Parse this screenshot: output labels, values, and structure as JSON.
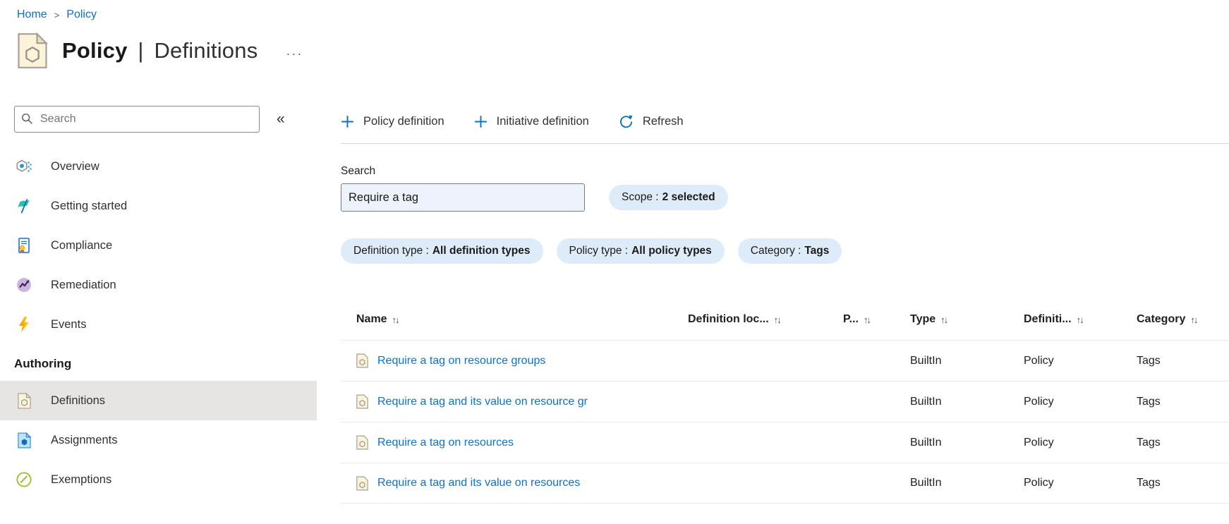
{
  "breadcrumb": {
    "separator": ">",
    "items": [
      {
        "label": "Home"
      },
      {
        "label": "Policy"
      }
    ]
  },
  "header": {
    "title_primary": "Policy",
    "title_separator": "|",
    "title_secondary": "Definitions",
    "more_glyph": "···"
  },
  "sidebar": {
    "search_placeholder": "Search",
    "collapse_glyph": "«",
    "items": [
      {
        "label": "Overview"
      },
      {
        "label": "Getting started"
      },
      {
        "label": "Compliance"
      },
      {
        "label": "Remediation"
      },
      {
        "label": "Events"
      }
    ],
    "section_label": "Authoring",
    "authoring_items": [
      {
        "label": "Definitions",
        "selected": true
      },
      {
        "label": "Assignments",
        "selected": false
      },
      {
        "label": "Exemptions",
        "selected": false
      }
    ]
  },
  "toolbar": {
    "buttons": [
      {
        "label": "Policy definition",
        "icon": "plus-icon"
      },
      {
        "label": "Initiative definition",
        "icon": "plus-icon"
      },
      {
        "label": "Refresh",
        "icon": "refresh-icon"
      }
    ]
  },
  "filters": {
    "search_label": "Search",
    "search_value": "Require a tag",
    "pills": [
      {
        "name": "Scope",
        "value": "2 selected"
      },
      {
        "name": "Definition type",
        "value": "All definition types"
      },
      {
        "name": "Policy type",
        "value": "All policy types"
      },
      {
        "name": "Category",
        "value": "Tags"
      }
    ]
  },
  "table": {
    "sort_glyph": "↑↓",
    "columns": [
      {
        "label": "Name"
      },
      {
        "label": "Definition loc..."
      },
      {
        "label": "P..."
      },
      {
        "label": "Type"
      },
      {
        "label": "Definiti..."
      },
      {
        "label": "Category"
      }
    ],
    "rows": [
      {
        "name": "Require a tag on resource groups",
        "definition_location": "",
        "policies": "",
        "type": "BuiltIn",
        "definition_type": "Policy",
        "category": "Tags"
      },
      {
        "name": "Require a tag and its value on resource gr",
        "definition_location": "",
        "policies": "",
        "type": "BuiltIn",
        "definition_type": "Policy",
        "category": "Tags"
      },
      {
        "name": "Require a tag on resources",
        "definition_location": "",
        "policies": "",
        "type": "BuiltIn",
        "definition_type": "Policy",
        "category": "Tags"
      },
      {
        "name": "Require a tag and its value on resources",
        "definition_location": "",
        "policies": "",
        "type": "BuiltIn",
        "definition_type": "Policy",
        "category": "Tags"
      }
    ]
  },
  "colors": {
    "accent": "#0078d4",
    "link": "#0b72ce",
    "pill_background": "#deecf9",
    "selected_item_background": "#e6e5e4",
    "filter_input_background": "#eef2fb"
  }
}
